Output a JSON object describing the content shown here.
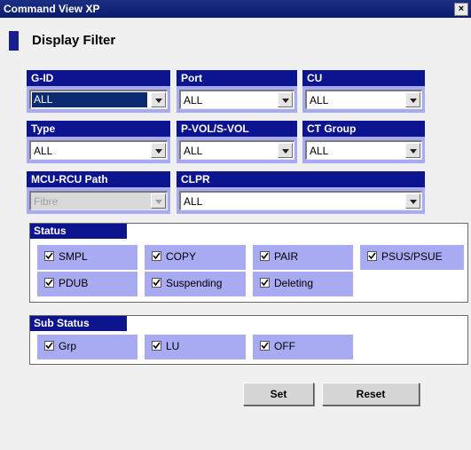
{
  "window": {
    "title": "Command View XP",
    "close_label": "×"
  },
  "heading": "Display Filter",
  "filters": {
    "gid": {
      "label": "G-ID",
      "value": "ALL"
    },
    "port": {
      "label": "Port",
      "value": "ALL"
    },
    "cu": {
      "label": "CU",
      "value": "ALL"
    },
    "type": {
      "label": "Type",
      "value": "ALL"
    },
    "pvol": {
      "label": "P-VOL/S-VOL",
      "value": "ALL"
    },
    "ctgroup": {
      "label": "CT Group",
      "value": "ALL"
    },
    "mcu": {
      "label": "MCU-RCU Path",
      "value": "Fibre"
    },
    "clpr": {
      "label": "CLPR",
      "value": "ALL"
    }
  },
  "status": {
    "title": "Status",
    "items": [
      {
        "label": "SMPL",
        "checked": true
      },
      {
        "label": "COPY",
        "checked": true
      },
      {
        "label": "PAIR",
        "checked": true
      },
      {
        "label": "PSUS/PSUE",
        "checked": true
      },
      {
        "label": "PDUB",
        "checked": true
      },
      {
        "label": "Suspending",
        "checked": true
      },
      {
        "label": "Deleting",
        "checked": true
      }
    ]
  },
  "sub_status": {
    "title": "Sub Status",
    "items": [
      {
        "label": "Grp",
        "checked": true
      },
      {
        "label": "LU",
        "checked": true
      },
      {
        "label": "OFF",
        "checked": true
      }
    ]
  },
  "buttons": {
    "set": "Set",
    "reset": "Reset"
  },
  "colors": {
    "header_blue": "#0d1490",
    "cell_lavender": "#a8aaf2",
    "titlebar_blue": "#1b2f84"
  }
}
